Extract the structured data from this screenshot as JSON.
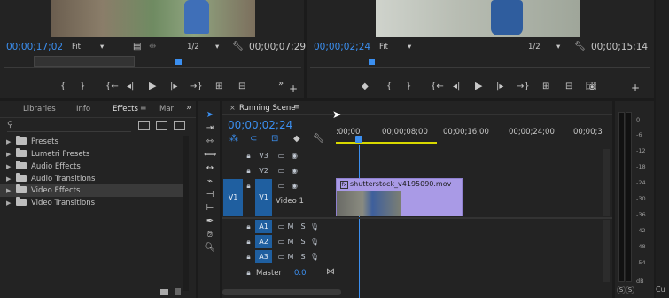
{
  "source_monitor": {
    "timecode_in": "00;00;17;02",
    "fit": "Fit",
    "resolution": "1/2",
    "timecode_dur": "00;00;07;29"
  },
  "program_monitor": {
    "timecode_in": "00;00;02;24",
    "fit": "Fit",
    "resolution": "1/2",
    "timecode_dur": "00;00;15;14"
  },
  "project_panel": {
    "tabs": [
      "Libraries",
      "Info",
      "Effects",
      "Mar"
    ],
    "active_tab": "Effects",
    "search_placeholder": "",
    "tree": [
      "Presets",
      "Lumetri Presets",
      "Audio Effects",
      "Audio Transitions",
      "Video Effects",
      "Video Transitions"
    ],
    "selected_item": "Video Effects"
  },
  "timeline": {
    "sequence_name": "Running Scene",
    "timecode": "00;00;02;24",
    "ruler": [
      ":00;00",
      "00;00;08;00",
      "00;00;16;00",
      "00;00;24;00",
      "00;00;3"
    ],
    "video_tracks": [
      {
        "label": "V3",
        "source": ""
      },
      {
        "label": "V2",
        "source": ""
      },
      {
        "label": "V1",
        "source": "V1",
        "name": "Video 1"
      }
    ],
    "audio_tracks": [
      {
        "label": "A1",
        "source": ""
      },
      {
        "label": "A2",
        "source": ""
      },
      {
        "label": "A3",
        "source": ""
      }
    ],
    "master_label": "Master",
    "master_value": "0.0",
    "clip_name": "shutterstock_v4195090.mov",
    "mute": "M",
    "solo": "S"
  },
  "audio_meter": {
    "ticks": [
      "0",
      "-6",
      "-12",
      "-18",
      "-24",
      "-30",
      "-36",
      "-42",
      "-48",
      "-54"
    ],
    "unit": "dB",
    "solo_buttons": [
      "S",
      "S"
    ]
  },
  "edge_label": "Cu",
  "colors": {
    "accent_blue": "#3b8ff0",
    "clip_purple": "#a99ae6",
    "work_area_yellow": "#d8d800"
  }
}
